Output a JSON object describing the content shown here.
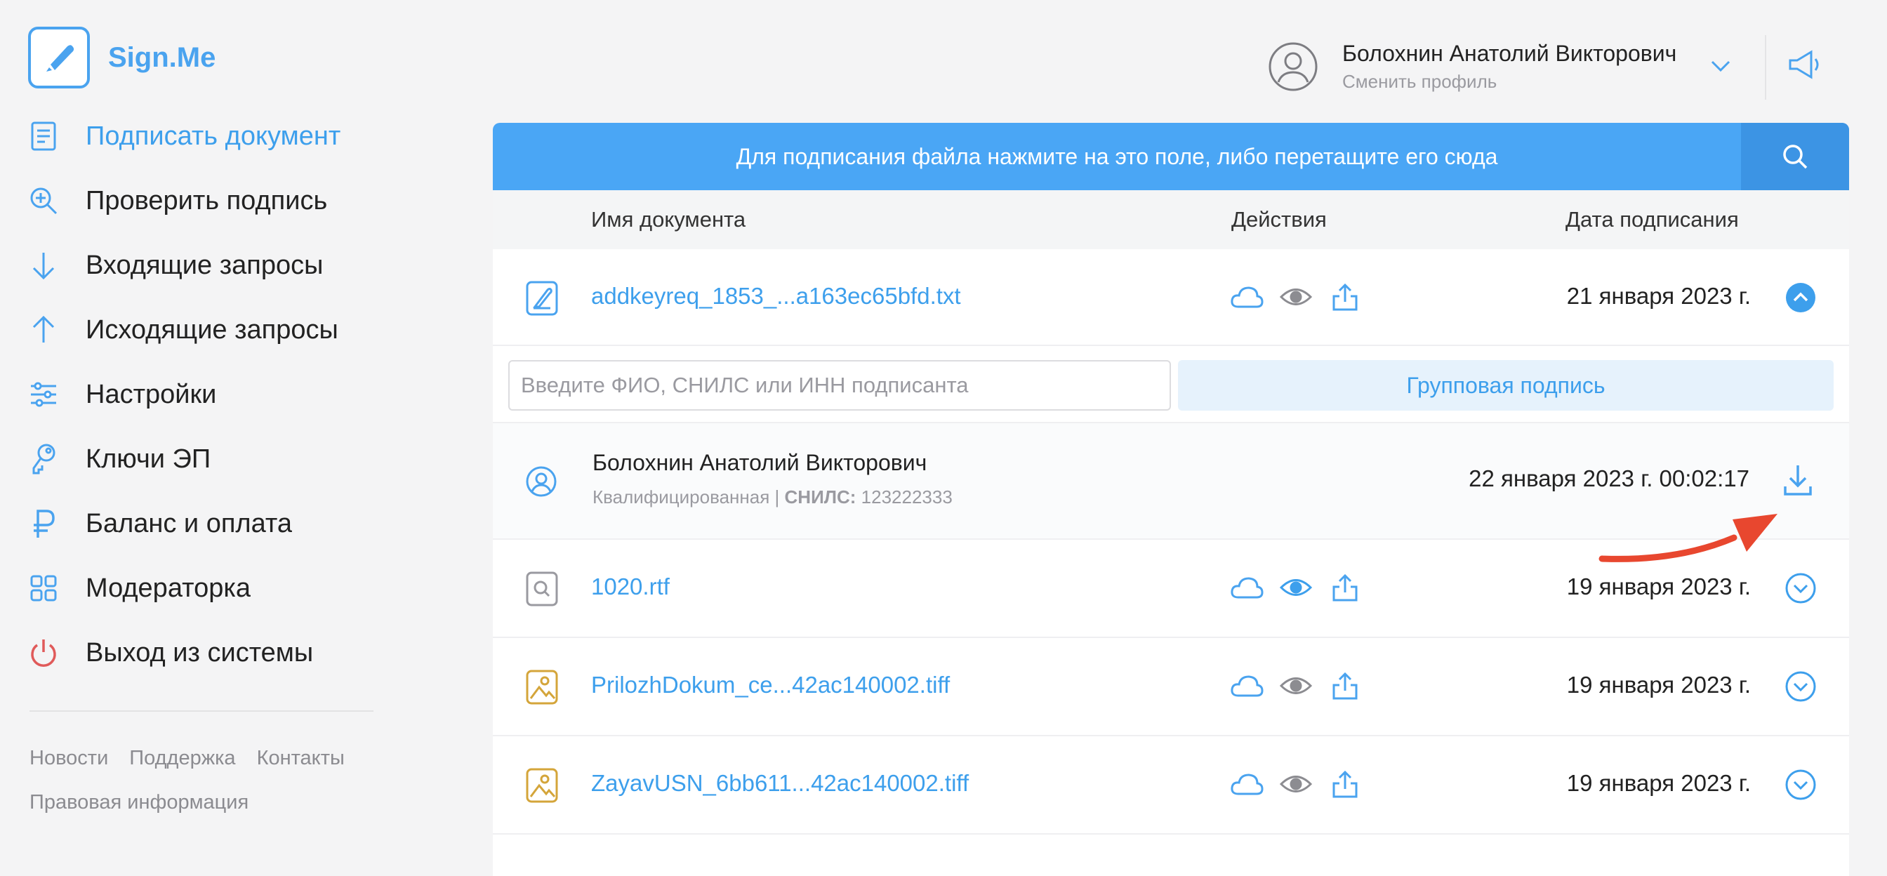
{
  "app": {
    "name": "Sign.Me"
  },
  "sidebar": {
    "items": [
      {
        "label": "Подписать документ",
        "icon": "document-icon",
        "active": true
      },
      {
        "label": "Проверить подпись",
        "icon": "magnifier-plus-icon"
      },
      {
        "label": "Входящие запросы",
        "icon": "arrow-down-icon"
      },
      {
        "label": "Исходящие запросы",
        "icon": "arrow-up-icon"
      },
      {
        "label": "Настройки",
        "icon": "sliders-icon"
      },
      {
        "label": "Ключи ЭП",
        "icon": "key-icon"
      },
      {
        "label": "Баланс и оплата",
        "icon": "ruble-icon"
      },
      {
        "label": "Модераторка",
        "icon": "grid-icon"
      },
      {
        "label": "Выход из системы",
        "icon": "power-icon"
      }
    ],
    "footer": {
      "news": "Новости",
      "support": "Поддержка",
      "contacts": "Контакты",
      "legal": "Правовая информация"
    }
  },
  "header": {
    "user_name": "Болохнин Анатолий Викторович",
    "switch_profile": "Сменить профиль"
  },
  "upload": {
    "text": "Для подписания файла нажмите на это поле, либо перетащите его сюда"
  },
  "table": {
    "col_name": "Имя документа",
    "col_actions": "Действия",
    "col_date": "Дата подписания"
  },
  "documents": [
    {
      "name": "addkeyreq_1853_...a163ec65bfd.txt",
      "date": "21 января 2023 г.",
      "icon": "signed-document-icon",
      "expanded": true
    },
    {
      "name": "1020.rtf",
      "date": "19 января 2023 г.",
      "icon": "search-document-icon"
    },
    {
      "name": "PrilozhDokum_ce...42ac140002.tiff",
      "date": "19 января 2023 г.",
      "icon": "image-file-icon"
    },
    {
      "name": "ZayavUSN_6bb611...42ac140002.tiff",
      "date": "19 января 2023 г.",
      "icon": "image-file-icon"
    }
  ],
  "sign_tools": {
    "signer_placeholder": "Введите ФИО, СНИЛС или ИНН подписанта",
    "group_sign": "Групповая подпись"
  },
  "signer": {
    "name": "Болохнин Анатолий Викторович",
    "type": "Квалифицированная",
    "snils_label": "СНИЛС:",
    "snils": "123222333",
    "datetime": "22 января 2023 г. 00:02:17"
  },
  "colors": {
    "accent": "#4aa3ef",
    "upload_bar": "#4aa6f5",
    "search_button": "#3c94e4",
    "logout_red": "#e05a5a",
    "image_file": "#d4a53a",
    "annotation_arrow": "#e8472f"
  }
}
